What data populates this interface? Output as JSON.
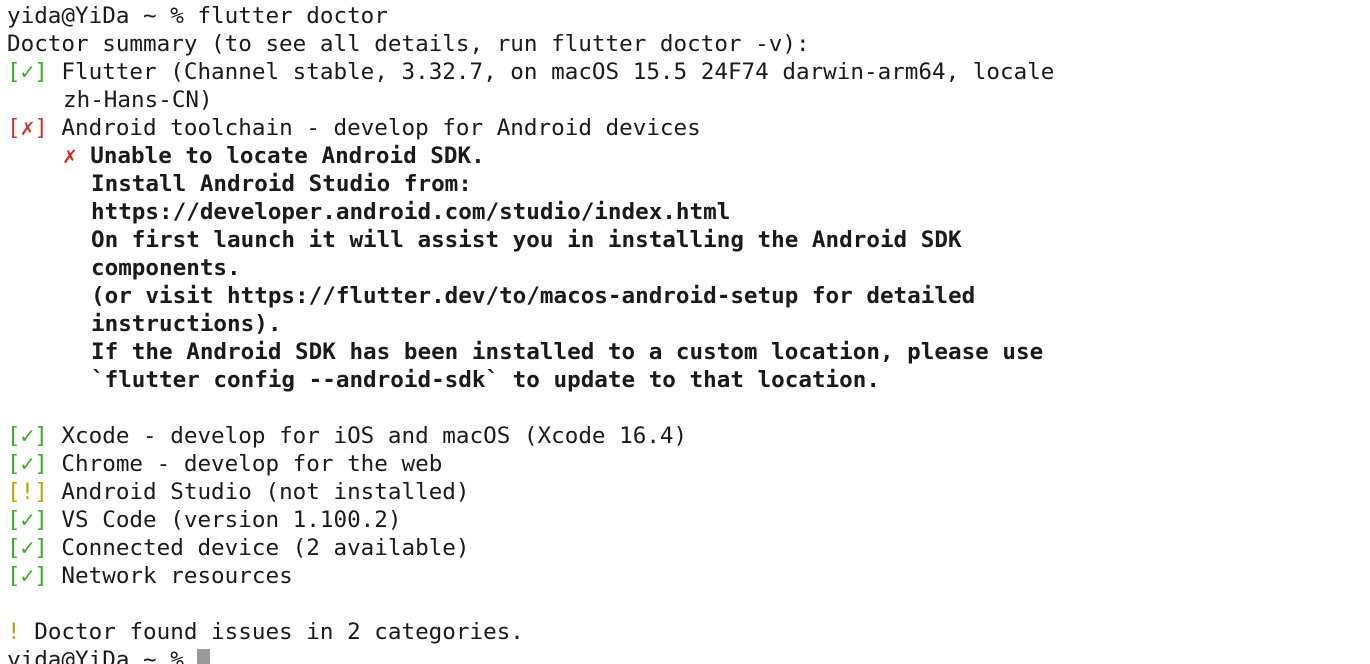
{
  "prompt1": {
    "text": "yida@YiDa ~ % ",
    "command": "flutter doctor"
  },
  "summary": "Doctor summary (to see all details, run flutter doctor -v):",
  "checks": [
    {
      "mark": "[✓]",
      "status": "ok",
      "text": "Flutter (Channel stable, 3.32.7, on macOS 15.5 24F74 darwin-arm64, locale",
      "continuation": "zh-Hans-CN)"
    },
    {
      "mark": "[✗]",
      "status": "error",
      "text": "Android toolchain - develop for Android devices"
    },
    {
      "mark": "[✓]",
      "status": "ok",
      "text": "Xcode - develop for iOS and macOS (Xcode 16.4)"
    },
    {
      "mark": "[✓]",
      "status": "ok",
      "text": "Chrome - develop for the web"
    },
    {
      "mark": "[!]",
      "status": "warning",
      "text": "Android Studio (not installed)"
    },
    {
      "mark": "[✓]",
      "status": "ok",
      "text": "VS Code (version 1.100.2)"
    },
    {
      "mark": "[✓]",
      "status": "ok",
      "text": "Connected device (2 available)"
    },
    {
      "mark": "[✓]",
      "status": "ok",
      "text": "Network resources"
    }
  ],
  "android_error": {
    "mark": "✗",
    "lines": [
      "Unable to locate Android SDK.",
      "Install Android Studio from:",
      "https://developer.android.com/studio/index.html",
      "On first launch it will assist you in installing the Android SDK",
      "components.",
      "(or visit https://flutter.dev/to/macos-android-setup for detailed",
      "instructions).",
      "If the Android SDK has been installed to a custom location, please use",
      "`flutter config --android-sdk` to update to that location."
    ]
  },
  "footer": {
    "mark": "!",
    "text": " Doctor found issues in 2 categories."
  },
  "prompt2": {
    "text": "yida@YiDa ~ % "
  },
  "colors": {
    "ok": "#3ea52e",
    "error": "#c13b2e",
    "warning": "#b8a40a",
    "text": "#1a1a1a",
    "cursor": "#9a9a9a"
  }
}
